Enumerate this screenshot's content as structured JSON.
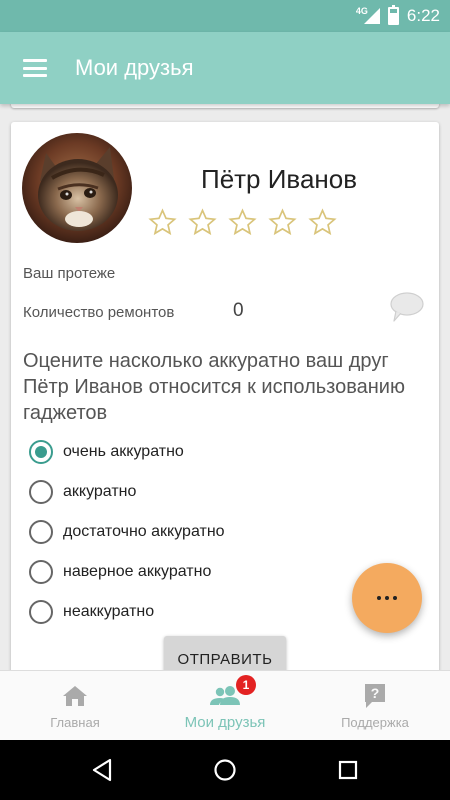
{
  "status_bar": {
    "network": "4G",
    "time": "6:22",
    "battery_level": 0.75
  },
  "app_bar": {
    "title": "Мои друзья"
  },
  "friend_card": {
    "name": "Пётр Иванов",
    "rating": {
      "value": 0,
      "max": 5
    },
    "relation": "Ваш протеже",
    "repairs_label": "Количество ремонтов",
    "repairs_count": "0",
    "question": "Оцените насколько аккуратно ваш друг Пётр Иванов относится к использованию гаджетов",
    "options": [
      {
        "label": "очень аккуратно",
        "checked": true
      },
      {
        "label": "аккуратно",
        "checked": false
      },
      {
        "label": "достаточно аккуратно",
        "checked": false
      },
      {
        "label": "наверное аккуратно",
        "checked": false
      },
      {
        "label": "неаккуратно",
        "checked": false
      }
    ],
    "submit_label": "ОТПРАВИТЬ"
  },
  "bottom_nav": {
    "items": [
      {
        "label": "Главная",
        "icon": "home-icon",
        "active": false
      },
      {
        "label": "Мои друзья",
        "icon": "friends-icon",
        "active": true,
        "badge": "1"
      },
      {
        "label": "Поддержка",
        "icon": "support-icon",
        "active": false
      }
    ]
  },
  "colors": {
    "status_bar": "#6fb9ac",
    "app_bar": "#8fd0c4",
    "accent": "#3a9c8e",
    "fab": "#f4aa5f",
    "star": "#d9c47a",
    "badge": "#e32222"
  }
}
